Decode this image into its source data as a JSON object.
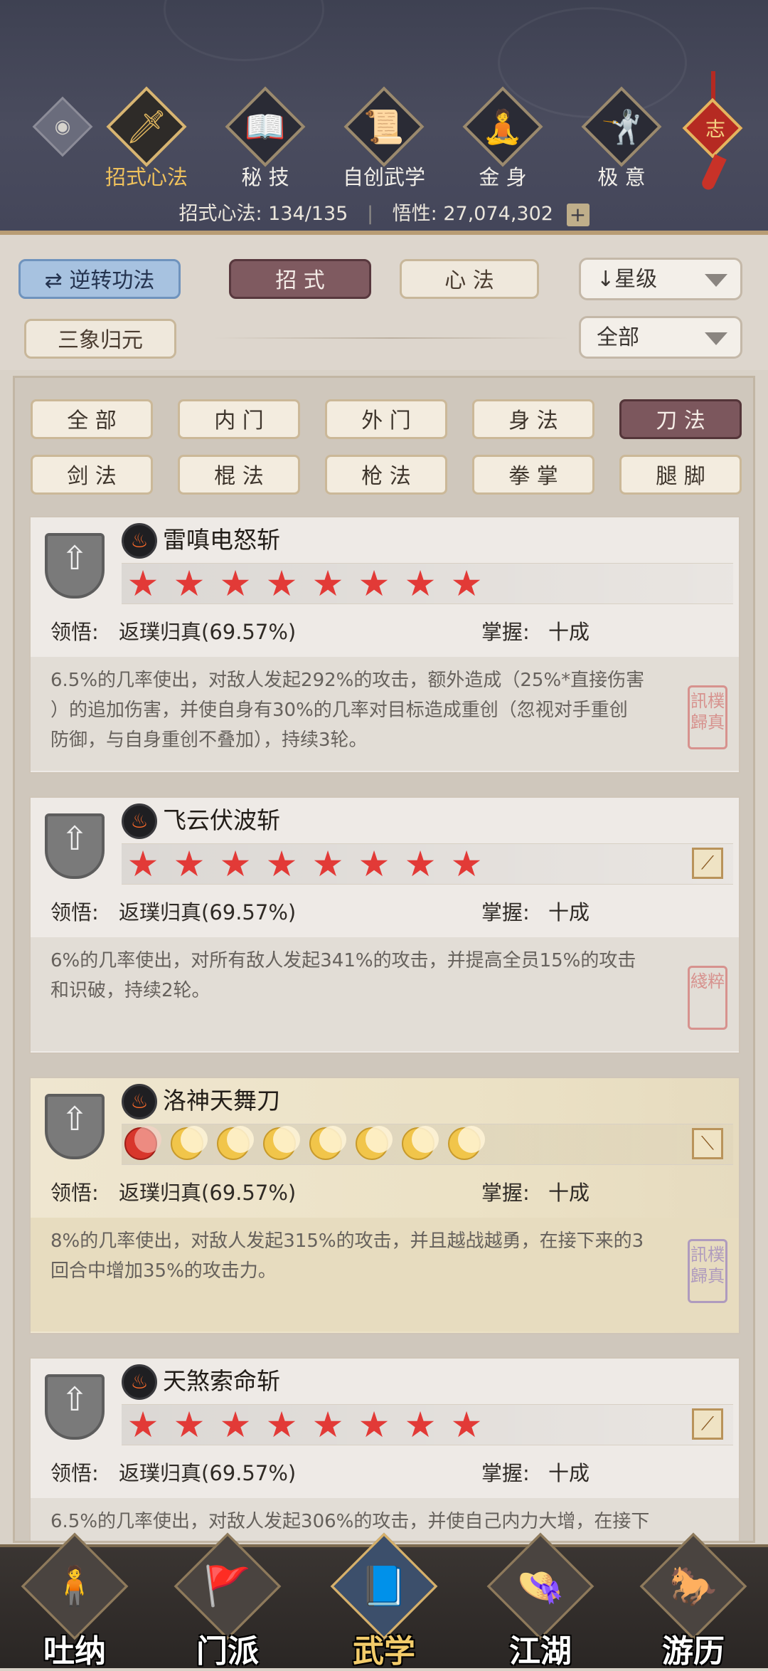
{
  "header": {
    "tabs": [
      {
        "label": "招式心法",
        "icon": "sword-icon",
        "active": true
      },
      {
        "label": "秘 技",
        "icon": "book-icon",
        "active": false
      },
      {
        "label": "自创武学",
        "icon": "scroll-icon",
        "active": false
      },
      {
        "label": "金 身",
        "icon": "meditation-icon",
        "active": false
      },
      {
        "label": "极 意",
        "icon": "martial-stance-icon",
        "active": false
      }
    ],
    "knot_char": "志",
    "stats": {
      "skills_label": "招式心法:",
      "skills_value": "134/135",
      "insight_label": "悟性:",
      "insight_value": "27,074,302",
      "plus": "+"
    }
  },
  "filters": {
    "reverse_button": "逆转功法",
    "tab_moves": "招 式",
    "tab_mind": "心 法",
    "sort_dropdown": "星级",
    "sanxiang_button": "三象归元",
    "scope_dropdown": "全部"
  },
  "categories": {
    "row1": [
      "全 部",
      "内 门",
      "外 门",
      "身 法",
      "刀 法"
    ],
    "row2": [
      "剑 法",
      "棍 法",
      "枪 法",
      "拳 掌",
      "腿 脚"
    ],
    "active": "刀 法"
  },
  "cards": [
    {
      "name": "雷嗔电怒斩",
      "rank_style": "stars",
      "stars": 8,
      "has_weapon_tag": false,
      "comprehension_label": "领悟:",
      "comprehension_value": "返璞归真(69.57%)",
      "mastery_label": "掌握:",
      "mastery_value": "十成",
      "desc_lines": [
        "6.5%的几率使出，对敌人发起292%的攻击，额外造成（25%*直接伤害",
        "）的追加伤害，并使自身有30%的几率对目标造成重创（忽视对手重创",
        "防御，与自身重创不叠加），持续3轮。"
      ],
      "seal": "訊樸歸真"
    },
    {
      "name": "飞云伏波斩",
      "rank_style": "stars",
      "stars": 8,
      "has_weapon_tag": true,
      "comprehension_label": "领悟:",
      "comprehension_value": "返璞归真(69.57%)",
      "mastery_label": "掌握:",
      "mastery_value": "十成",
      "desc_lines": [
        "6%的几率使出，对所有敌人发起341%的攻击，并提高全员15%的攻击",
        "和识破，持续2轮。"
      ],
      "seal": "綫粹"
    },
    {
      "name": "洛神天舞刀",
      "rank_style": "moons",
      "stars": 8,
      "has_weapon_tag": true,
      "comprehension_label": "领悟:",
      "comprehension_value": "返璞归真(69.57%)",
      "mastery_label": "掌握:",
      "mastery_value": "十成",
      "desc_lines": [
        "8%的几率使出，对敌人发起315%的攻击，并且越战越勇，在接下来的3",
        "回合中增加35%的攻击力。"
      ],
      "seal": "訊樸歸真"
    },
    {
      "name": "天煞索命斩",
      "rank_style": "stars",
      "stars": 8,
      "has_weapon_tag": true,
      "comprehension_label": "领悟:",
      "comprehension_value": "返璞归真(69.57%)",
      "mastery_label": "掌握:",
      "mastery_value": "十成",
      "desc_lines": [
        "6.5%的几率使出，对敌人发起306%的攻击，并使自己内力大增，在接下"
      ],
      "seal": ""
    }
  ],
  "bottom_nav": [
    {
      "label": "吐纳",
      "icon": "monk-icon",
      "active": false
    },
    {
      "label": "门派",
      "icon": "sect-banners-icon",
      "active": false
    },
    {
      "label": "武学",
      "icon": "martial-book-icon",
      "active": true
    },
    {
      "label": "江湖",
      "icon": "straw-hat-icon",
      "active": false
    },
    {
      "label": "游历",
      "icon": "horse-icon",
      "active": false
    }
  ]
}
